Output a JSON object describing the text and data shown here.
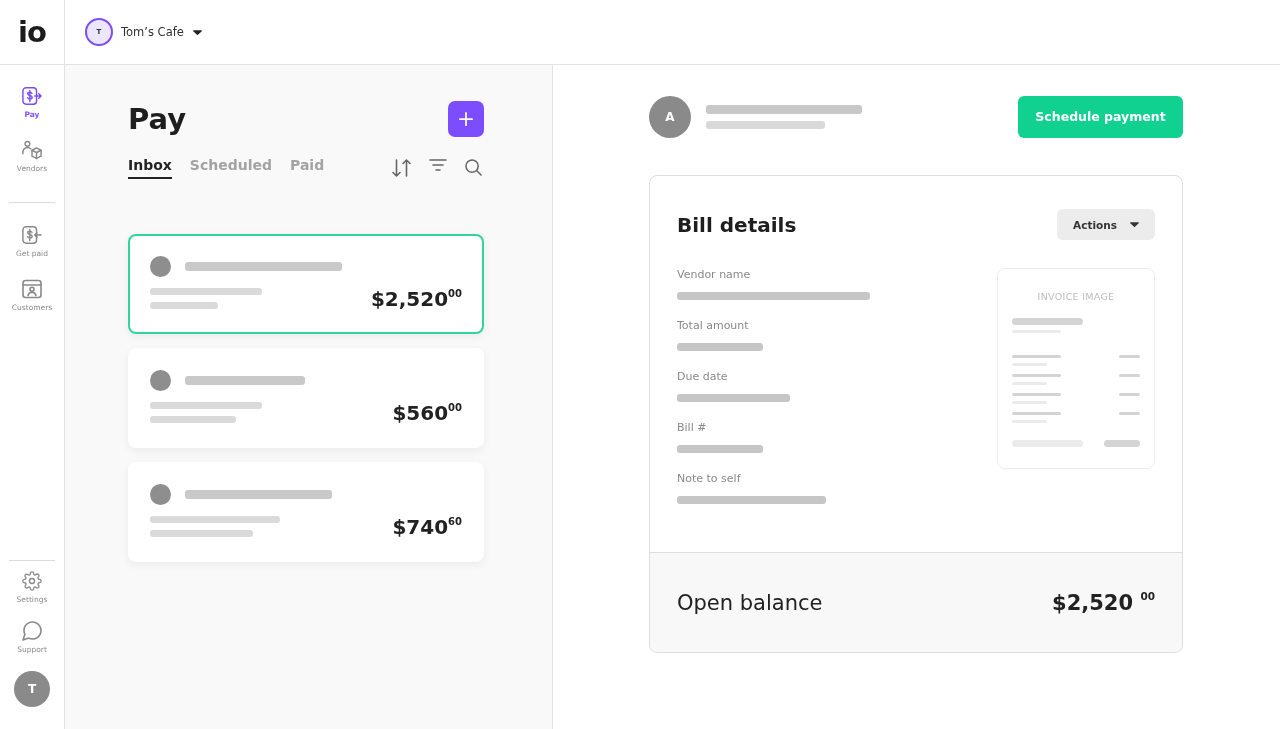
{
  "logo": "io",
  "company": {
    "initial": "T",
    "name": "Tom’s Cafe"
  },
  "sidebar": {
    "items": [
      {
        "label": "Pay",
        "selected": true
      },
      {
        "label": "Vendors",
        "selected": false
      },
      {
        "label": "Get paid",
        "selected": false
      },
      {
        "label": "Customers",
        "selected": false
      }
    ],
    "bottom_items": [
      {
        "label": "Settings",
        "selected": false
      },
      {
        "label": "Support",
        "selected": false
      }
    ],
    "user": {
      "initial": "T"
    }
  },
  "pay_panel": {
    "title": "Pay",
    "tabs": [
      {
        "label": "Inbox",
        "selected": true
      },
      {
        "label": "Scheduled",
        "selected": false
      },
      {
        "label": "Paid",
        "selected": false
      }
    ],
    "bills": [
      {
        "amount": "$2,520$^{00}$",
        "selected": true
      },
      {
        "amount": "$560$^{00}$",
        "selected": false
      },
      {
        "amount": "$740$^{60}$",
        "selected": false
      }
    ]
  },
  "bill_detail": {
    "vendor": {
      "initial": "A"
    },
    "primary_button": "Schedule payment",
    "card": {
      "title": "Bill details",
      "actions_button": "Actions",
      "fields": [
        {
          "label": "Vendor name"
        },
        {
          "label": "Total amount"
        },
        {
          "label": "Due date"
        },
        {
          "label": "Bill #"
        },
        {
          "label": "Note to self"
        }
      ],
      "invoice_image": {
        "label": "INVOICE IMAGE"
      },
      "open_balance": {
        "label": "Open balance",
        "amount": "$2,520 $^{00}$"
      }
    }
  }
}
